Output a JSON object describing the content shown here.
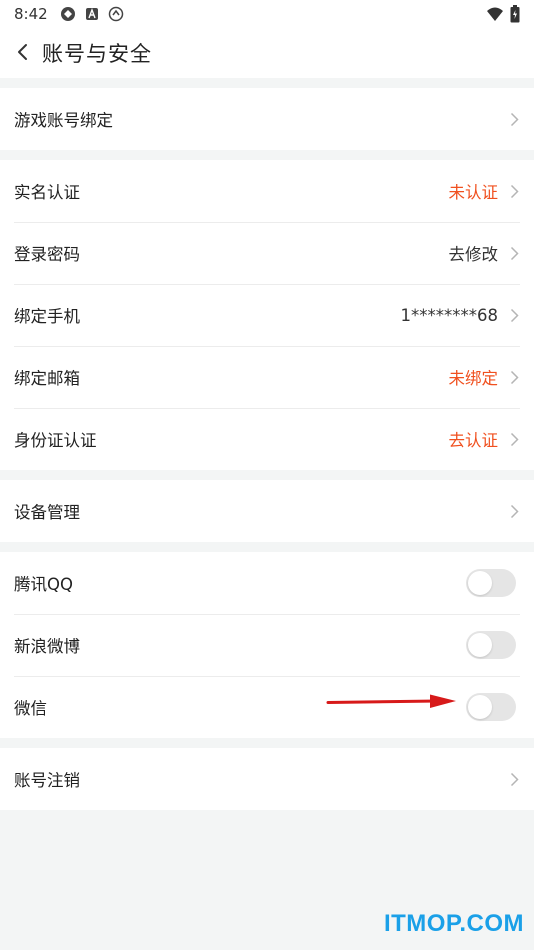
{
  "status_bar": {
    "time": "8:42",
    "icons": [
      "app-icon-1",
      "app-icon-2",
      "app-icon-3"
    ],
    "right_icons": [
      "wifi-icon",
      "battery-icon"
    ]
  },
  "header": {
    "title": "账号与安全",
    "back_icon": "chevron-left-icon"
  },
  "groups": {
    "game": {
      "items": [
        {
          "label": "游戏账号绑定",
          "value": ""
        }
      ]
    },
    "security": {
      "items": [
        {
          "label": "实名认证",
          "value": "未认证"
        },
        {
          "label": "登录密码",
          "value": "去修改"
        },
        {
          "label": "绑定手机",
          "value": "1********68"
        },
        {
          "label": "绑定邮箱",
          "value": "未绑定"
        },
        {
          "label": "身份证认证",
          "value": "去认证"
        }
      ]
    },
    "device": {
      "items": [
        {
          "label": "设备管理",
          "value": ""
        }
      ]
    },
    "social": {
      "items": [
        {
          "label": "腾讯QQ",
          "on": false
        },
        {
          "label": "新浪微博",
          "on": false
        },
        {
          "label": "微信",
          "on": false
        }
      ]
    },
    "account": {
      "items": [
        {
          "label": "账号注销",
          "value": ""
        }
      ]
    }
  },
  "watermark": "ITMOP.COM",
  "colors": {
    "accent_red": "#f0501f",
    "background": "#f3f5f5",
    "toggle_off": "#e5e5e5",
    "watermark": "#1aa0e8",
    "annotation_arrow": "#d71a1a"
  }
}
